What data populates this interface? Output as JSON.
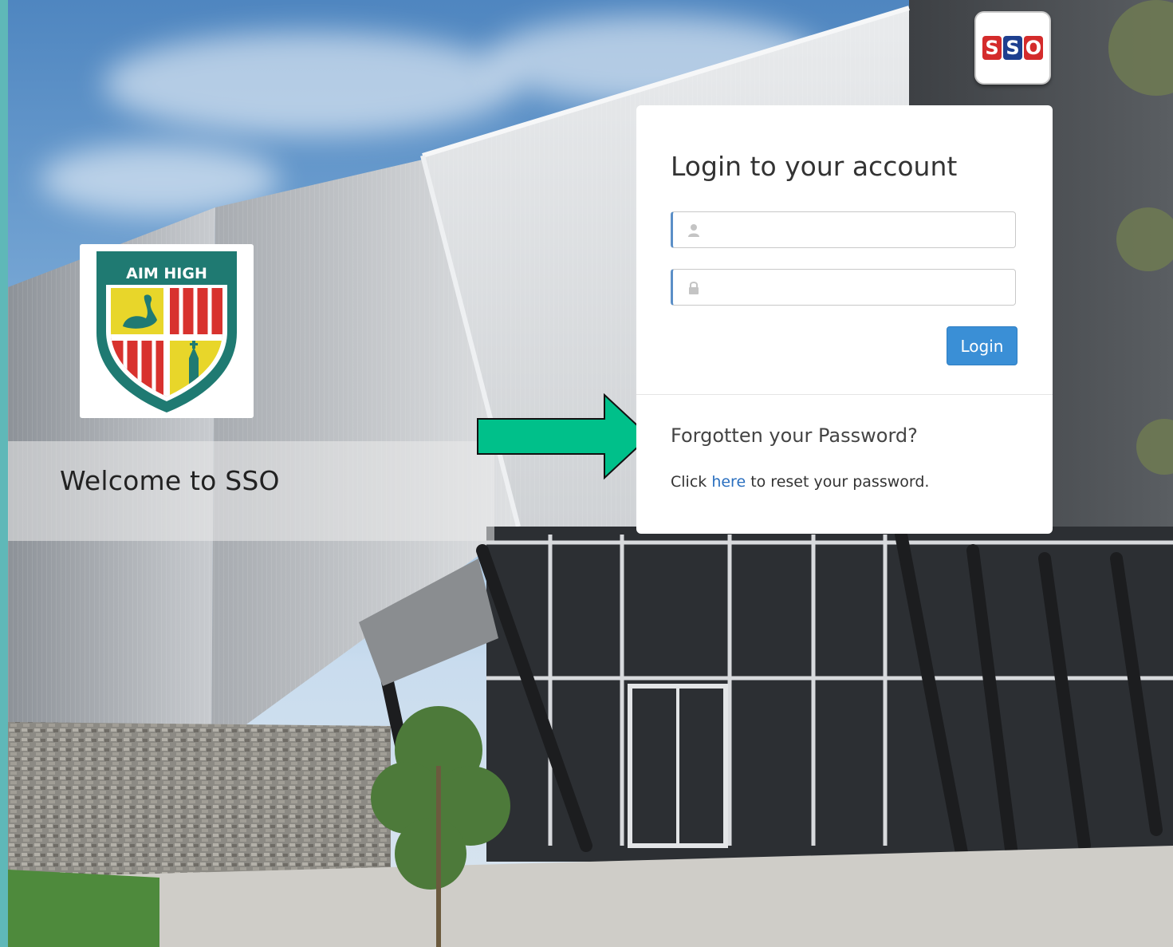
{
  "logo": {
    "motto": "AIM HIGH"
  },
  "welcome": {
    "text": "Welcome to SSO"
  },
  "badge": {
    "letters": [
      "S",
      "S",
      "O"
    ],
    "colors": [
      "#d42b2b",
      "#1e3f8f",
      "#d42b2b"
    ]
  },
  "login": {
    "title": "Login to your account",
    "username_value": "",
    "password_value": "",
    "button_label": "Login"
  },
  "forgot": {
    "title": "Forgotten your Password?",
    "prefix": "Click ",
    "link_text": "here",
    "suffix": " to reset your password."
  },
  "colors": {
    "accent": "#3a8fd6",
    "link": "#2a6fbf",
    "arrow": "#00c08a",
    "frame": "#5fb8b8"
  },
  "icons": {
    "username": "user-icon",
    "password": "lock-icon",
    "pointer": "right-arrow-icon"
  }
}
